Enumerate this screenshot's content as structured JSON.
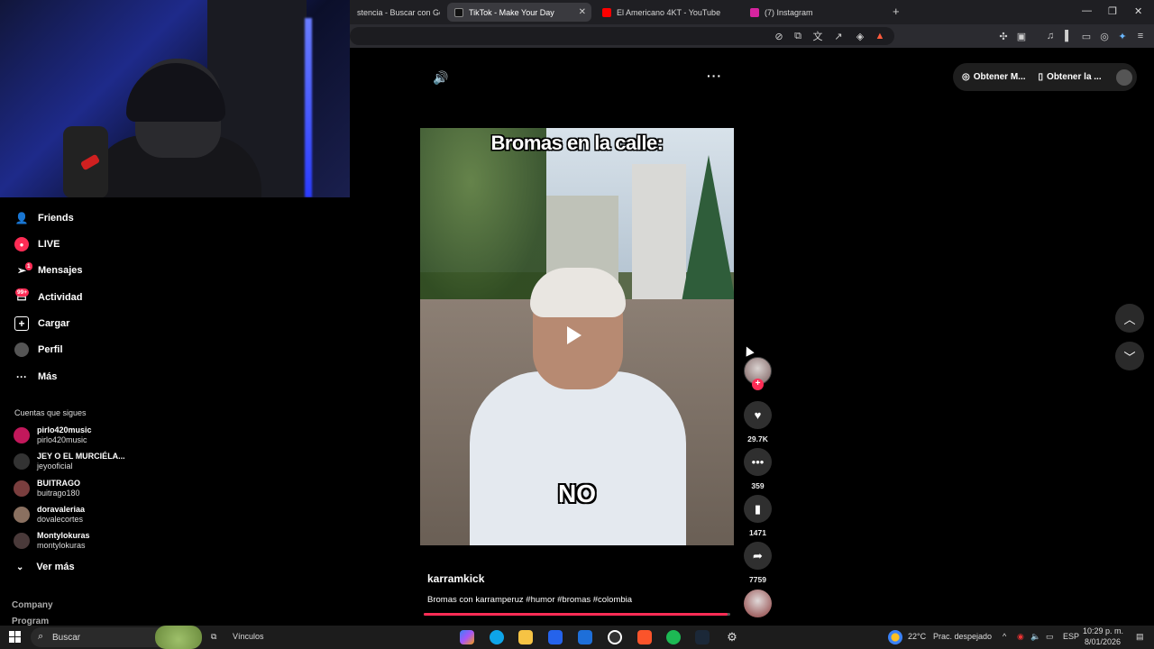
{
  "browser": {
    "tabs": [
      {
        "label": "stencia - Buscar con Googl",
        "color": "#4285f4"
      },
      {
        "label": "TikTok - Make Your Day",
        "color": "#111111"
      },
      {
        "label": "El Americano 4KT - YouTube",
        "color": "#ff0000"
      },
      {
        "label": "(7) Instagram",
        "color": "#d6249f"
      }
    ],
    "close_tab": "✕",
    "new_tab": "+"
  },
  "sidebar": {
    "items": [
      {
        "label": "Friends",
        "icon": "friends-icon"
      },
      {
        "label": "LIVE",
        "icon": "live-icon"
      },
      {
        "label": "Mensajes",
        "icon": "messages-icon",
        "badge": "1"
      },
      {
        "label": "Actividad",
        "icon": "activity-icon",
        "badge": "99+"
      },
      {
        "label": "Cargar",
        "icon": "upload-icon"
      },
      {
        "label": "Perfil",
        "icon": "profile-icon"
      },
      {
        "label": "Más",
        "icon": "more-icon"
      }
    ],
    "following_title": "Cuentas que sigues",
    "accounts": [
      {
        "name": "pirlo420music",
        "handle": "pirlo420music",
        "color": "#c2185b"
      },
      {
        "name": "JEY O EL MURCIÉLA...",
        "handle": "jeyooficial",
        "color": "#333333"
      },
      {
        "name": "BUITRAGO",
        "handle": "buitrago180",
        "color": "#7a3e3e"
      },
      {
        "name": "doravaleriaa",
        "handle": "dovalecortes",
        "color": "#8a7060"
      },
      {
        "name": "Montylokuras",
        "handle": "montylokuras",
        "color": "#4a3a3a"
      }
    ],
    "see_more": "Ver más",
    "footer": [
      "Company",
      "Program"
    ]
  },
  "video": {
    "caption": "Bromas en la calle:",
    "subtitle": "NO",
    "author": "karramkick",
    "description": "Bromas con karramperuz #humor #bromas #colombia",
    "progress": 0.99
  },
  "actions": {
    "likes": "29.7K",
    "comments": "359",
    "saves": "1471",
    "shares": "7759"
  },
  "header": {
    "get_app_1": "Obtener M...",
    "get_app_2": "Obtener la ..."
  },
  "taskbar": {
    "search": "Buscar",
    "vinculos": "Vínculos",
    "weather": "22°C",
    "weather_desc": "Prac. despejado",
    "lang": "ESP",
    "time": "10:29 p. m.",
    "date": "8/01/2026"
  }
}
